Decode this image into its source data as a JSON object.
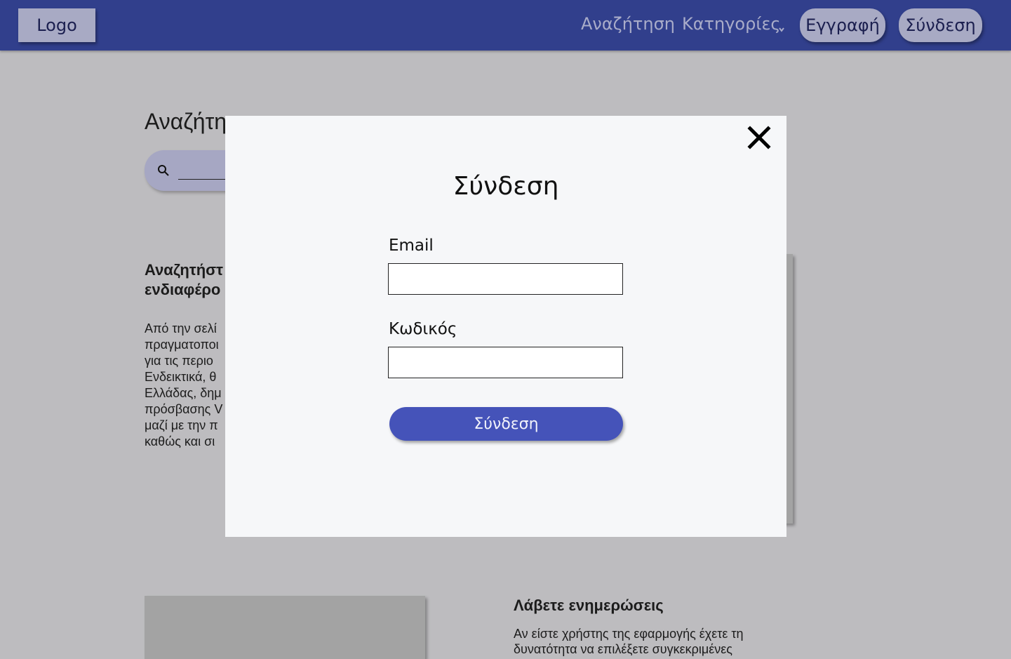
{
  "colors": {
    "navbar": "#313f8c",
    "page_background": "#bdbcbf",
    "pill_background": "#a8aac4",
    "modal_background": "#f6f7f9",
    "primary_button": "#4553b9"
  },
  "navbar": {
    "logo": "Logo",
    "search_link": "Αναζήτηση",
    "categories_link": "Κατηγορίες",
    "categories_icon": "chevron-down-icon",
    "register_button": "Εγγραφή",
    "login_button": "Σύνδεση"
  },
  "background": {
    "heading": "Αναζήτη",
    "search_icon": "search-icon",
    "subheading_lines": [
      "Αναζητήστ",
      "ενδιαφέρο"
    ],
    "paragraph_lines": [
      "Από την σελί",
      "πραγματοποι",
      "για τις περιο",
      "Ενδεικτικά, θ",
      "Ελλάδας, δημ",
      "πρόσβασης V",
      "μαζί με την π",
      "καθώς και σι"
    ],
    "updates_title": "Λάβετε ενημερώσεις",
    "updates_lines": [
      "Αν είστε χρήστης της εφαρμογής έχετε τη",
      "δυνατότητα να επιλέξετε συγκεκριμένες"
    ]
  },
  "modal": {
    "close_icon": "close-icon",
    "title": "Σύνδεση",
    "email_label": "Email",
    "email_value": "",
    "password_label": "Κωδικός",
    "password_value": "",
    "submit_label": "Σύνδεση"
  }
}
